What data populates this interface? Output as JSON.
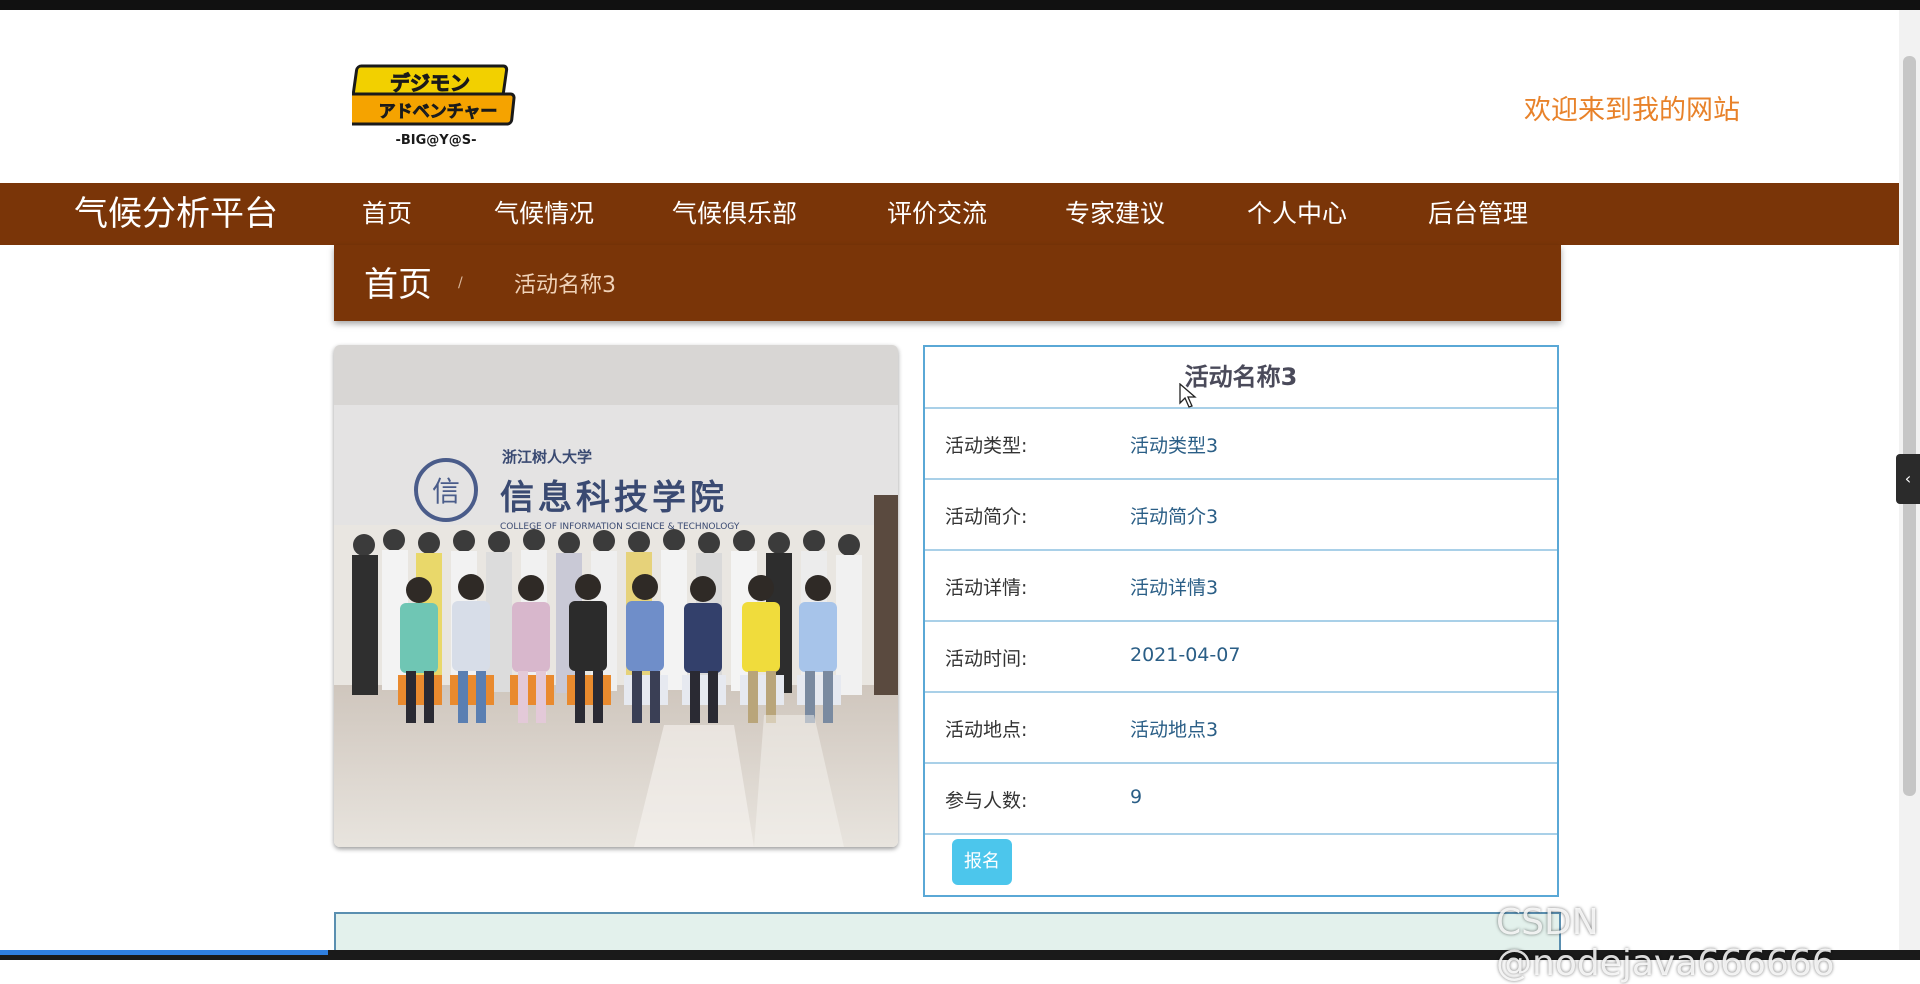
{
  "header": {
    "welcome_text": "欢迎来到我的网站",
    "logo_text_top": "デジモン",
    "logo_text_mid": "アドベンチャー",
    "logo_text_bottom": "-BIG@Y@S-"
  },
  "nav": {
    "brand": "气候分析平台",
    "items": [
      {
        "label": "首页"
      },
      {
        "label": "气候情况"
      },
      {
        "label": "气候俱乐部"
      },
      {
        "label": "评价交流"
      },
      {
        "label": "专家建议"
      },
      {
        "label": "个人中心"
      },
      {
        "label": "后台管理"
      }
    ]
  },
  "breadcrumb": {
    "home": "首页",
    "separator": "/",
    "current": "活动名称3"
  },
  "photo": {
    "banner_small": "浙江树人大学",
    "banner_large": "信息科技学院",
    "banner_en": "COLLEGE OF INFORMATION SCIENCE & TECHNOLOGY"
  },
  "detail": {
    "title": "活动名称3",
    "rows": [
      {
        "label": "活动类型:",
        "value": "活动类型3"
      },
      {
        "label": "活动简介:",
        "value": "活动简介3"
      },
      {
        "label": "活动详情:",
        "value": "活动详情3"
      },
      {
        "label": "活动时间:",
        "value": "2021-04-07"
      },
      {
        "label": "活动地点:",
        "value": "活动地点3"
      },
      {
        "label": "参与人数:",
        "value": "9"
      }
    ],
    "signup_label": "报名"
  },
  "side_tab": {
    "icon": "‹"
  },
  "watermark": "CSDN @nodejava666666",
  "colors": {
    "nav_bg": "#7a3508",
    "welcome": "#e8822a",
    "accent_border": "#5aa8d6",
    "button": "#4cc6ec"
  }
}
